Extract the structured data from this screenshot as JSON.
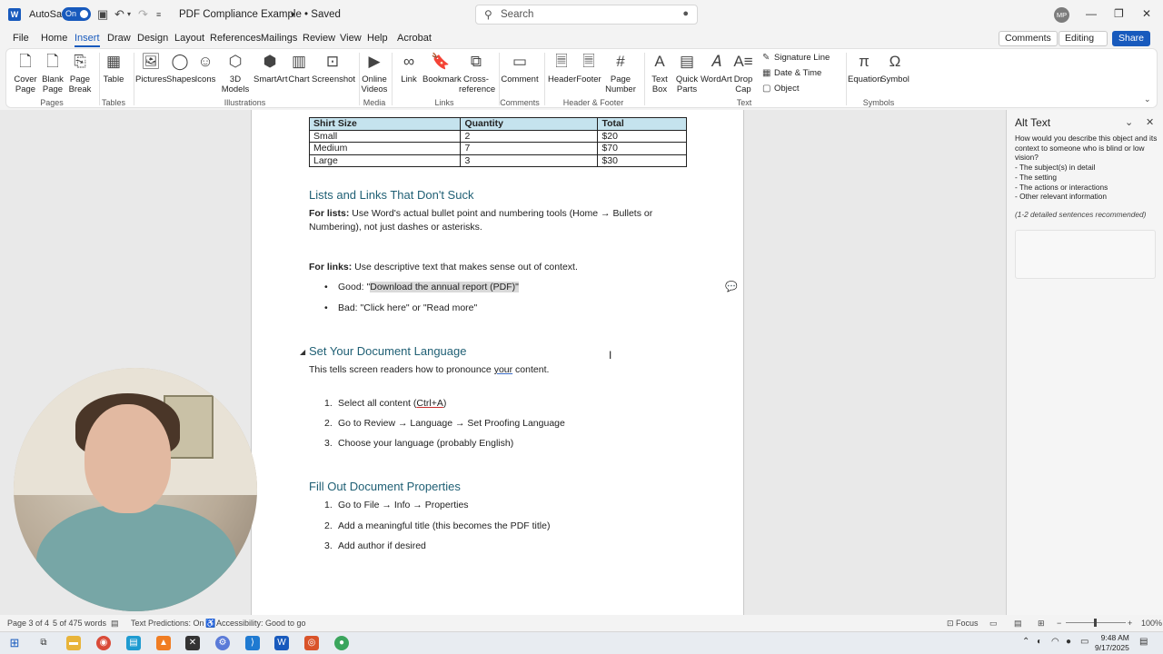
{
  "titlebar": {
    "autosave_label": "AutoSave",
    "autosave_state": "On",
    "doc_title": "PDF Compliance Example • Saved",
    "search_placeholder": "Search",
    "avatar_initials": "MP"
  },
  "tabs": [
    "File",
    "Home",
    "Insert",
    "Draw",
    "Design",
    "Layout",
    "References",
    "Mailings",
    "Review",
    "View",
    "Help",
    "Acrobat"
  ],
  "active_tab": "Insert",
  "right_buttons": {
    "comments": "Comments",
    "editing": "Editing",
    "share": "Share"
  },
  "ribbon": {
    "pages": {
      "cover": "Cover Page",
      "blank": "Blank Page",
      "break": "Page Break",
      "label": "Pages"
    },
    "tables": {
      "table": "Table",
      "label": "Tables"
    },
    "illustrations": {
      "pictures": "Pictures",
      "shapes": "Shapes",
      "icons": "Icons",
      "models": "3D Models",
      "smartart": "SmartArt",
      "chart": "Chart",
      "screenshot": "Screenshot",
      "label": "Illustrations"
    },
    "media": {
      "video": "Online Videos",
      "label": "Media"
    },
    "links": {
      "link": "Link",
      "bookmark": "Bookmark",
      "crossref": "Cross-reference",
      "label": "Links"
    },
    "comments": {
      "comment": "Comment",
      "label": "Comments"
    },
    "header_footer": {
      "header": "Header",
      "footer": "Footer",
      "page_number": "Page Number",
      "label": "Header & Footer"
    },
    "text": {
      "textbox": "Text Box",
      "quickparts": "Quick Parts",
      "wordart": "WordArt",
      "dropcap": "Drop Cap",
      "signature": "Signature Line",
      "datetime": "Date & Time",
      "object": "Object",
      "label": "Text"
    },
    "symbols": {
      "equation": "Equation",
      "symbol": "Symbol",
      "label": "Symbols"
    }
  },
  "document": {
    "table": {
      "headers": [
        "Shirt Size",
        "Quantity",
        "Total"
      ],
      "rows": [
        [
          "Small",
          "2",
          "$20"
        ],
        [
          "Medium",
          "7",
          "$70"
        ],
        [
          "Large",
          "3",
          "$30"
        ]
      ]
    },
    "h_lists": "Lists and Links That Don't Suck",
    "lists_bold": "For lists:",
    "lists_text": " Use Word's actual bullet point and numbering tools (Home → Bullets or Numbering), not just dashes or asterisks.",
    "links_bold": "For links:",
    "links_text": " Use descriptive text that makes sense out of context.",
    "good_prefix": "Good: \"",
    "good_link": "Download the annual report (PDF)\"",
    "bad": "Bad: \"Click here\" or \"Read more\"",
    "h_language": "Set Your Document Language",
    "lang_text_a": "This tells screen readers how to pronounce ",
    "lang_text_b": "your",
    "lang_text_c": " content.",
    "lang_steps": [
      "Select all content (",
      "Go to Review → Language → Set Proofing Language",
      "Choose your language (probably English)"
    ],
    "ctrl_a": "Ctrl+A",
    "ctrl_close": ")",
    "h_props": "Fill Out Document Properties",
    "props_steps": [
      "Go to File → Info → Properties",
      "Add a meaningful title (this becomes the PDF title)",
      "Add author if desired"
    ]
  },
  "alt_pane": {
    "title": "Alt Text",
    "prompt": "How would you describe this object and its context to someone who is blind or low vision?",
    "items": [
      "- The subject(s) in detail",
      "- The setting",
      "- The actions or interactions",
      "- Other relevant information"
    ],
    "hint": "(1-2 detailed sentences recommended)"
  },
  "status": {
    "page": "Page 3 of 4",
    "words": "5 of 475 words",
    "predictions": "Text Predictions: On",
    "accessibility": "Accessibility: Good to go",
    "focus": "Focus",
    "zoom": "100%"
  },
  "clock": {
    "time": "9:48 AM",
    "date": "9/17/2025"
  },
  "colors": {
    "accent": "#185abd",
    "heading": "#1f5f74",
    "table_header": "#c5e3ee"
  }
}
